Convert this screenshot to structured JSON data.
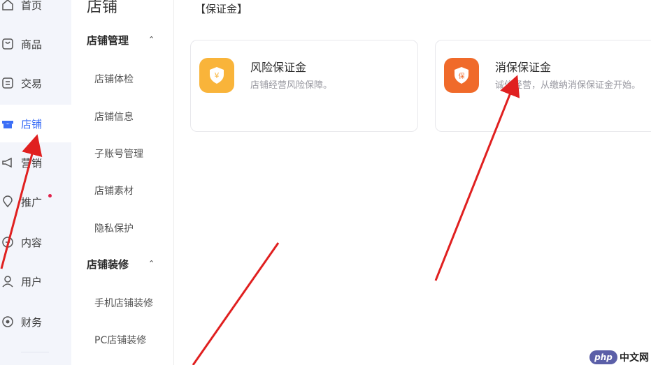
{
  "leftnav": {
    "items": [
      {
        "label": "首页",
        "icon": "home-icon"
      },
      {
        "label": "商品",
        "icon": "goods-icon"
      },
      {
        "label": "交易",
        "icon": "trade-icon"
      },
      {
        "label": "店铺",
        "icon": "store-icon",
        "active": true
      },
      {
        "label": "营销",
        "icon": "megaphone-icon"
      },
      {
        "label": "推广",
        "icon": "location-pin-icon"
      },
      {
        "label": "内容",
        "icon": "content-icon"
      },
      {
        "label": "用户",
        "icon": "user-icon"
      },
      {
        "label": "财务",
        "icon": "finance-icon"
      }
    ]
  },
  "submenu": {
    "title": "店铺",
    "groups": [
      {
        "title": "店铺管理",
        "items": [
          "店铺体检",
          "店铺信息",
          "子账号管理",
          "店铺素材",
          "隐私保护"
        ]
      },
      {
        "title": "店铺装修",
        "items": [
          "手机店铺装修",
          "PC店铺装修"
        ]
      }
    ]
  },
  "main": {
    "section_label": "【保证金】",
    "cards": [
      {
        "title": "风险保证金",
        "desc": "店铺经营风险保障。",
        "badge_glyph": "¥",
        "color": "#f9b43a"
      },
      {
        "title": "消保保证金",
        "desc": "诚信经营，从缴纳消保保证金开始。",
        "badge_glyph": "保",
        "color": "#f06a2a"
      }
    ]
  },
  "watermark": {
    "logo": "php",
    "text": "中文网"
  },
  "colors": {
    "accent": "#3b6ef6",
    "arrow": "#e02020"
  }
}
